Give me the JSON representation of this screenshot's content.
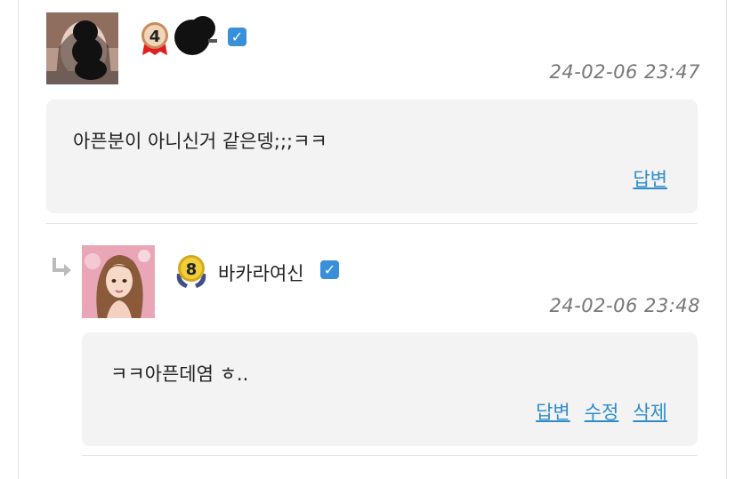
{
  "comments": [
    {
      "nickname": "",
      "level": "4",
      "verified": "✓",
      "timestamp": "24-02-06 23:47",
      "text": "아픈분이 아니신거 같은뎅;;;ㅋㅋ",
      "actions": [
        "답변"
      ]
    },
    {
      "nickname": "바카라여신",
      "level": "8",
      "verified": "✓",
      "timestamp": "24-02-06 23:48",
      "text": "ㅋㅋ아픈데염 ㅎ..",
      "actions": [
        "답변",
        "수정",
        "삭제"
      ]
    }
  ],
  "colors": {
    "link": "#2f8ccc",
    "verified": "#3a8fd9",
    "bubble": "#f3f3f3",
    "timestamp": "#777777"
  },
  "icons": {
    "verified": "checkbox-check-icon",
    "reply": "reply-arrow-icon",
    "level4": "level-medal-4-icon",
    "level8": "level-wreath-8-icon"
  }
}
